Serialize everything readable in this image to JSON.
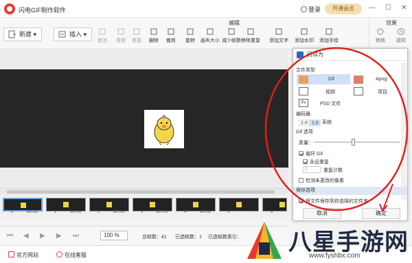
{
  "app": {
    "title": "闪电GIF制作软件"
  },
  "titlebar": {
    "login": "登录",
    "vip": "开通会员",
    "minimize": "—",
    "maximize": "☐",
    "close": "✕"
  },
  "toolbar": {
    "section_edit": "编辑",
    "section_effects": "效果",
    "new_label": "新建",
    "insert_label": "插入",
    "tools": [
      "撤消",
      "重做",
      "重置",
      "删除",
      "裁剪",
      "旋转",
      "画布大小",
      "减少帧数",
      "移除重复",
      "添加文字",
      "添加水印",
      "添加手绘"
    ],
    "effects": [
      "特效",
      "延时"
    ]
  },
  "frames": [
    {
      "num": "0",
      "ms": "66 ms"
    },
    {
      "num": "1",
      "ms": "64 ms"
    },
    {
      "num": "2",
      "ms": "80 ms"
    },
    {
      "num": "3",
      "ms": "80 ms"
    },
    {
      "num": "4",
      "ms": "66 ms"
    },
    {
      "num": "5",
      "ms": ""
    },
    {
      "num": "6",
      "ms": ""
    }
  ],
  "playback": {
    "zoom_value": "100",
    "zoom_unit": "%",
    "total_frames_label": "总帧数：",
    "total_frames": "41",
    "selected_label": "已选帧数：",
    "selected_value": "1",
    "selected_index_label": "已选帧数索引："
  },
  "footer": {
    "official_site": "官方网站",
    "support": "在线客服"
  },
  "dialog": {
    "title": "另存为",
    "file_type_label": "文件类型",
    "types": [
      "Gif",
      "Apng",
      "视频",
      "项目",
      "PSD 文件"
    ],
    "selected_type": "Gif",
    "encoder_label": "编码器",
    "encoders": [
      "2.0",
      "1.0",
      "系统"
    ],
    "gif_options_label": "Gif 选项",
    "quality_label": "质量：",
    "loop_label": "循环 Gif",
    "repeat_forever_label": "永远重复",
    "repeat_count_value": "2",
    "repeat_count_label": "重复计数",
    "detect_unchanged_label": "检测未更改的像素",
    "save_options_label": "保存选项",
    "save_to_folder_label": "将文件保存到你选择的文件夹",
    "cancel_label": "取消",
    "ok_label": "确定"
  },
  "watermark": {
    "text": "八星手游网",
    "url": "www.fyshbx.com"
  },
  "colors": {
    "accent": "#e83a2f",
    "annotation": "#e0201a",
    "selection": "#cfe0fb",
    "canvas": "#262626"
  }
}
